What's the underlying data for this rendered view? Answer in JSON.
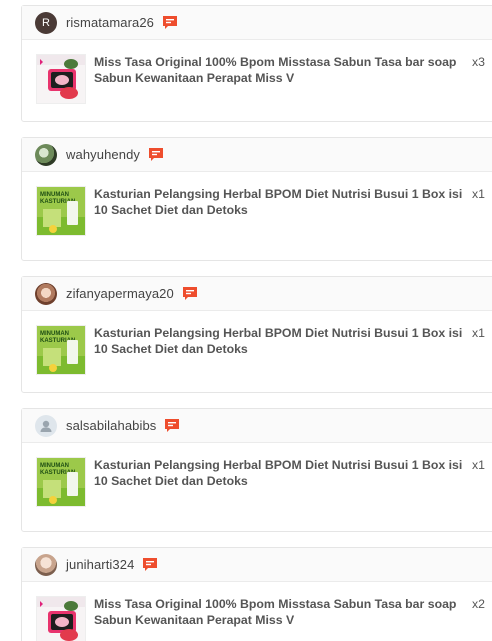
{
  "orders": [
    {
      "username": "rismatamara26",
      "avatar_letter": "R",
      "avatar_type": "letter",
      "product_name": "Miss Tasa Original 100% Bpom Misstasa Sabun Tasa bar soap Sabun Kewanitaan Perapat Miss V",
      "quantity": "x3",
      "product_image": "misstasa-soap"
    },
    {
      "username": "wahyuhendy",
      "avatar_type": "photo",
      "product_name": "Kasturian Pelangsing Herbal BPOM Diet Nutrisi Busui 1 Box isi 10 Sachet Diet dan Detoks",
      "quantity": "x1",
      "product_image": "minuman-kasturian"
    },
    {
      "username": "zifanyapermaya20",
      "avatar_type": "photo",
      "product_name": "Kasturian Pelangsing Herbal BPOM Diet Nutrisi Busui 1 Box isi 10 Sachet Diet dan Detoks",
      "quantity": "x1",
      "product_image": "minuman-kasturian"
    },
    {
      "username": "salsabilahabibs",
      "avatar_type": "default",
      "product_name": "Kasturian Pelangsing Herbal BPOM Diet Nutrisi Busui 1 Box isi 10 Sachet Diet dan Detoks",
      "quantity": "x1",
      "product_image": "minuman-kasturian"
    },
    {
      "username": "juniharti324",
      "avatar_type": "photo",
      "product_name": "Miss Tasa Original 100% Bpom Misstasa Sabun Tasa bar soap Sabun Kewanitaan Perapat Miss V",
      "quantity": "x2",
      "product_image": "misstasa-soap"
    }
  ],
  "thumb_text": {
    "kasturian_line1": "MINUMAN",
    "kasturian_line2": "KASTURIAN"
  },
  "colors": {
    "chat_icon": "#ee4d2d",
    "header_bg": "#fafafa",
    "border": "#e5e5e5",
    "kasturian_green": "#7dbb2f"
  },
  "icons": {
    "chat": "chat-icon",
    "default_avatar": "user-icon"
  }
}
